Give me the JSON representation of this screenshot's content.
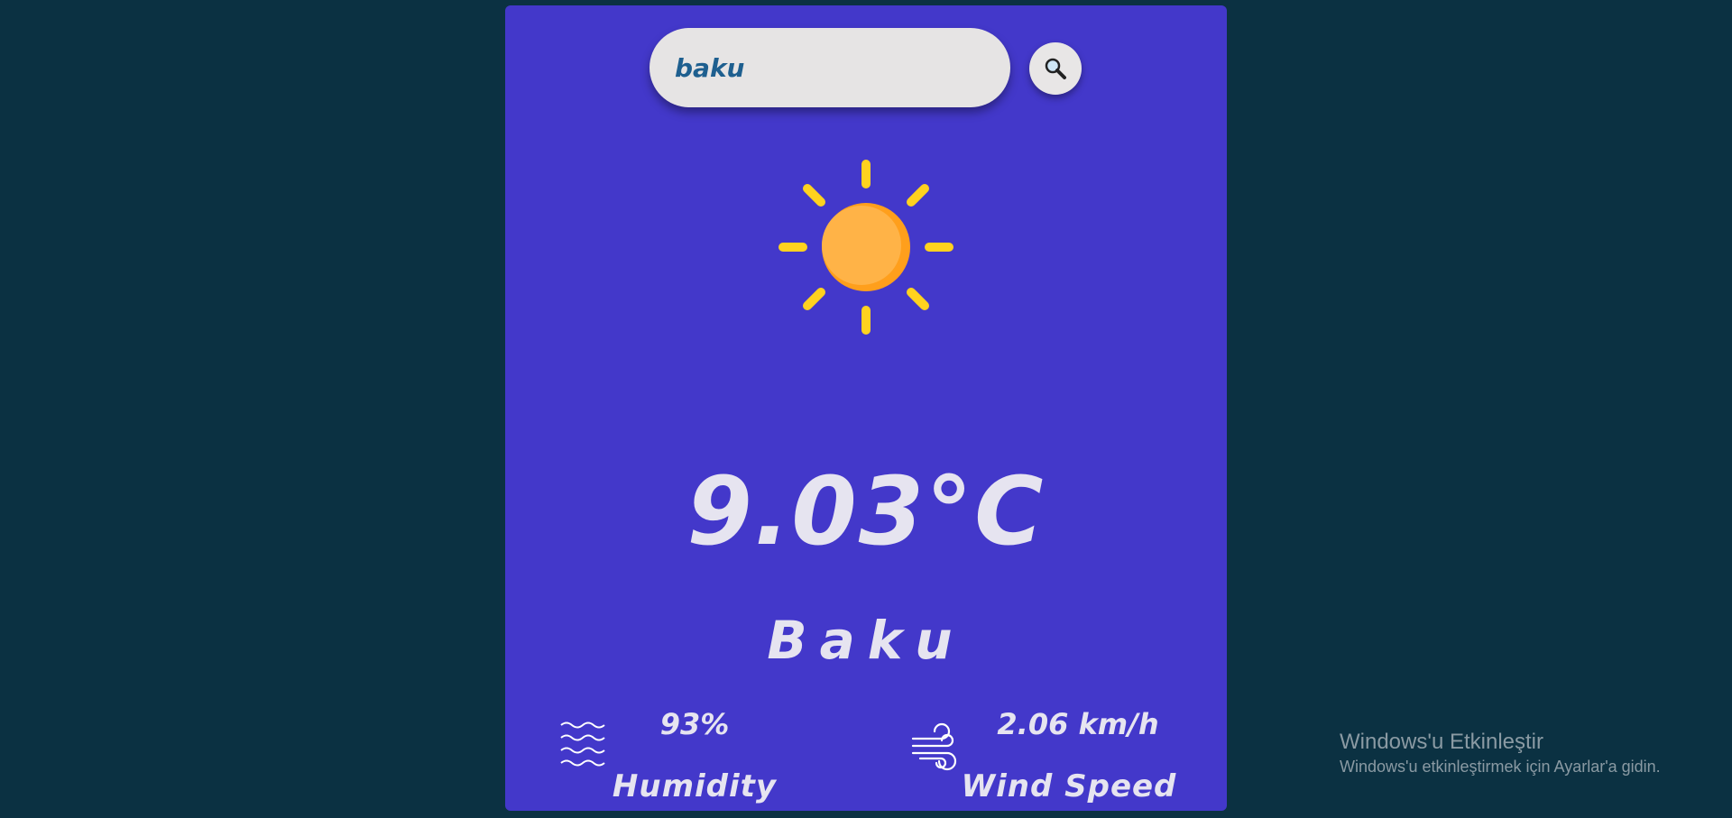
{
  "search": {
    "value": "baku",
    "icon": "search-icon"
  },
  "weather": {
    "icon": "sun-icon",
    "temperature": "9.03°C",
    "city": "Baku"
  },
  "humidity": {
    "value": "93%",
    "label": "Humidity",
    "icon": "humidity-icon"
  },
  "wind": {
    "value": "2.06 km/h",
    "label": "Wind Speed",
    "icon": "wind-icon"
  },
  "os_watermark": {
    "title": "Windows'u Etkinleştir",
    "subtitle": "Windows'u etkinleştirmek için Ayarlar'a gidin."
  },
  "colors": {
    "page_background": "#0b3142",
    "card_background": "#4338ca",
    "sun": "#ffb347",
    "sun_rays": "#ffd21f",
    "text": "#e6e4f0",
    "search_text": "#1e5f8f"
  }
}
